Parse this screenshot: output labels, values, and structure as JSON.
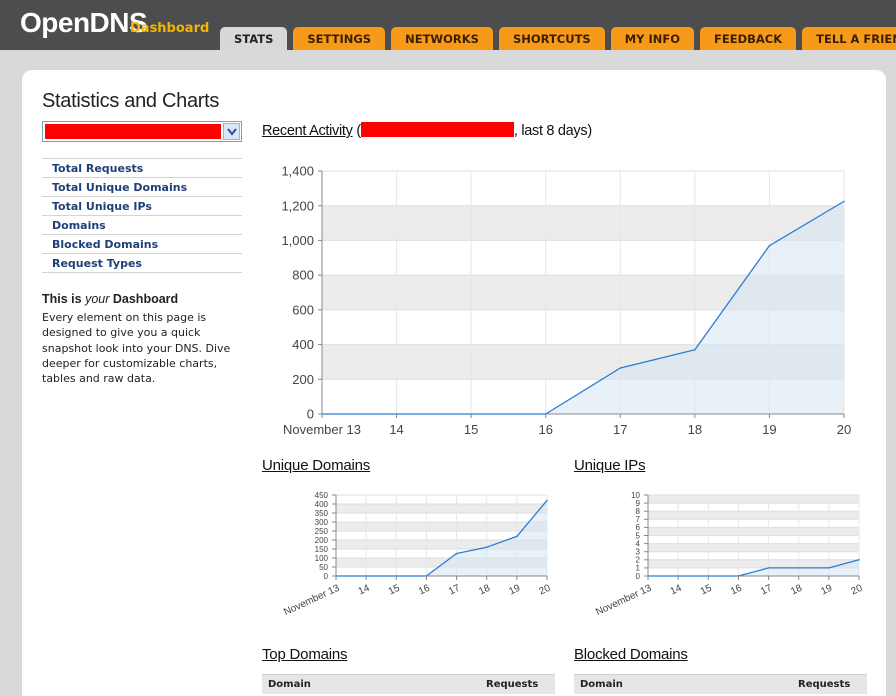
{
  "header": {
    "logo": "OpenDNS",
    "logo_sub": "Dashboard",
    "tabs": [
      {
        "label": "STATS",
        "active": true
      },
      {
        "label": "SETTINGS"
      },
      {
        "label": "NETWORKS"
      },
      {
        "label": "SHORTCUTS"
      },
      {
        "label": "MY INFO"
      },
      {
        "label": "FEEDBACK"
      },
      {
        "label": "TELL A FRIEND"
      }
    ]
  },
  "sidebar": {
    "title": "Statistics and Charts",
    "nav": [
      {
        "label": "Total Requests"
      },
      {
        "label": "Total Unique Domains"
      },
      {
        "label": "Total Unique IPs"
      },
      {
        "label": "Domains"
      },
      {
        "label": "Blocked Domains"
      },
      {
        "label": "Request Types"
      }
    ],
    "dashboard_heading_prefix": "This is ",
    "dashboard_heading_em": "your",
    "dashboard_heading_suffix": " Dashboard",
    "dashboard_desc": "Every element on this page is designed to give you a quick snapshot look into your DNS. Dive deeper for customizable charts, tables and raw data."
  },
  "main": {
    "recent_title": "Recent Activity",
    "recent_open": " (",
    "recent_suffix": ", last 8 days)",
    "unique_domains_title": "Unique Domains",
    "unique_ips_title": "Unique IPs",
    "top_domains_title": "Top Domains",
    "blocked_domains_title": "Blocked Domains",
    "table_col_domain": "Domain",
    "table_col_requests": "Requests"
  },
  "colors": {
    "tab_orange": "#f79a1a",
    "tab_active": "#d8d8d8",
    "header_bg": "#4c4d4f",
    "logo_accent": "#f5b400",
    "nav_link": "#1f3f78",
    "line": "#2a7fd4"
  },
  "chart_data": [
    {
      "type": "area",
      "title": "Recent Activity",
      "x": [
        "November 13",
        "14",
        "15",
        "16",
        "17",
        "18",
        "19",
        "20"
      ],
      "values": [
        0,
        0,
        0,
        0,
        265,
        370,
        970,
        1225
      ],
      "ylim": [
        0,
        1400
      ],
      "yticks": [
        "0",
        "200",
        "400",
        "600",
        "800",
        "1,000",
        "1,200",
        "1,400"
      ],
      "grid": true
    },
    {
      "type": "area",
      "title": "Unique Domains",
      "x": [
        "November 13",
        "14",
        "15",
        "16",
        "17",
        "18",
        "19",
        "20"
      ],
      "values": [
        0,
        0,
        0,
        0,
        125,
        160,
        220,
        420
      ],
      "ylim": [
        0,
        450
      ],
      "yticks": [
        "0",
        "50",
        "100",
        "150",
        "200",
        "250",
        "300",
        "350",
        "400",
        "450"
      ],
      "grid": true
    },
    {
      "type": "area",
      "title": "Unique IPs",
      "x": [
        "November 13",
        "14",
        "15",
        "16",
        "17",
        "18",
        "19",
        "20"
      ],
      "values": [
        0,
        0,
        0,
        0,
        1,
        1,
        1,
        2
      ],
      "ylim": [
        0,
        10
      ],
      "yticks": [
        "0",
        "1",
        "2",
        "3",
        "4",
        "5",
        "6",
        "7",
        "8",
        "9",
        "10"
      ],
      "grid": true
    }
  ]
}
